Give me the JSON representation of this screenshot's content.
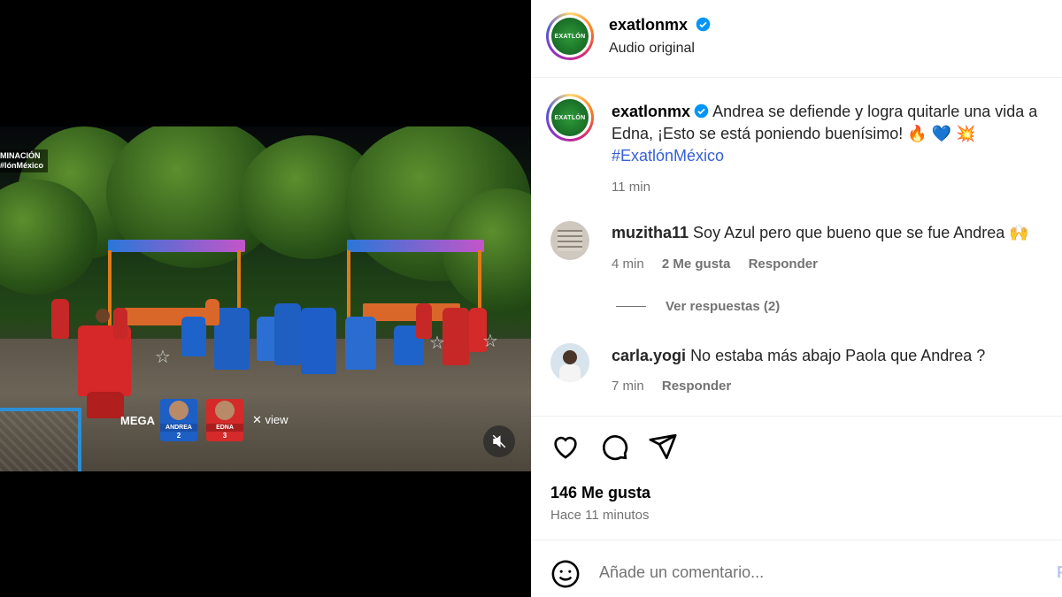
{
  "video": {
    "corner_label_line1": "MINACIÓN",
    "corner_label_line2": "#lónMéxico",
    "broadcaster": "MEGA",
    "partner": "view",
    "contestants": [
      {
        "name": "ANDREA",
        "number": "2",
        "team_color": "#1d5fc4"
      },
      {
        "name": "EDNA",
        "number": "3",
        "team_color": "#d42a2a"
      }
    ]
  },
  "post": {
    "author": {
      "username": "exatlonmx",
      "subtitle": "Audio original",
      "avatar_text": "EXATLÓN"
    },
    "caption": {
      "username": "exatlonmx",
      "text": "Andrea se defiende y logra quitarle una vida a Edna, ¡Esto se está poniendo buenísimo!",
      "emojis": "🔥 💙 💥",
      "hashtag": "#ExatlónMéxico",
      "time": "11 min"
    },
    "comments": [
      {
        "username": "muzitha11",
        "text": "Soy Azul pero que bueno que se fue Andrea 🙌",
        "time": "4 min",
        "likes": "2 Me gusta",
        "reply_label": "Responder",
        "view_replies": "Ver respuestas (2)"
      },
      {
        "username": "carla.yogi",
        "text": "No estaba más abajo Paola que Andrea ?",
        "time": "7 min",
        "reply_label": "Responder"
      }
    ],
    "likes_count": "146 Me gusta",
    "posted_ago": "Hace 11 minutos",
    "comment_placeholder": "Añade un comentario...",
    "post_button": "P"
  },
  "colors": {
    "verified": "#0095f6",
    "hashtag": "#385fd4",
    "muted_text": "#737373"
  }
}
